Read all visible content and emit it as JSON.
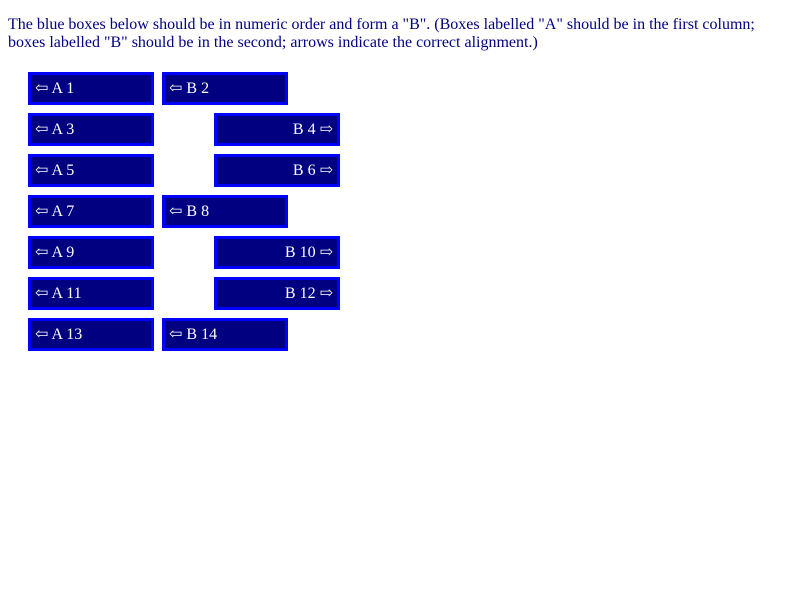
{
  "instructions": "The blue boxes below should be in numeric order and form a \"B\". (Boxes labelled \"A\" should be in the first column; boxes labelled \"B\" should be in the second; arrows indicate the correct alignment.)",
  "rows": [
    {
      "a": "⇦ A 1",
      "b": "⇦ B 2"
    },
    {
      "a": "⇦ A 3",
      "b": "B 4 ⇨"
    },
    {
      "a": "⇦ A 5",
      "b": "B 6 ⇨"
    },
    {
      "a": "⇦ A 7",
      "b": "⇦ B 8"
    },
    {
      "a": "⇦ A 9",
      "b": "B 10 ⇨"
    },
    {
      "a": "⇦ A 11",
      "b": "B 12 ⇨"
    },
    {
      "a": "⇦ A 13",
      "b": "⇦ B 14"
    }
  ],
  "colors": {
    "text": "#000080",
    "box_fill": "#000080",
    "box_border": "#0000ff",
    "box_text": "#ffffff"
  }
}
